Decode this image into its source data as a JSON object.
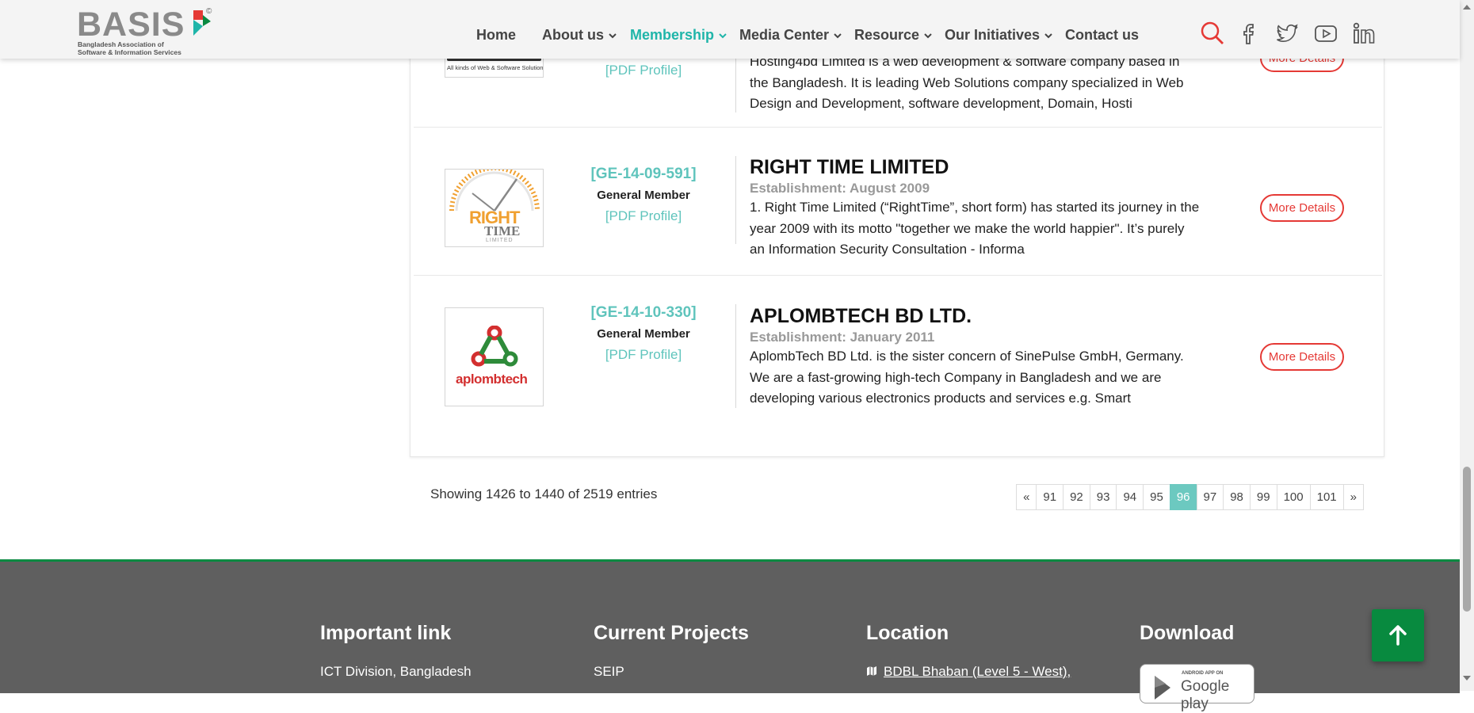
{
  "header": {
    "logo_text": "BASIS",
    "logo_reg": "©",
    "logo_sub_line1": "Bangladesh Association of",
    "logo_sub_line2": "Software & Information Services",
    "nav": [
      {
        "label": "Home"
      },
      {
        "label": "About us"
      },
      {
        "label": "Membership"
      },
      {
        "label": "Media Center"
      },
      {
        "label": "Resource"
      },
      {
        "label": "Our Initiatives"
      },
      {
        "label": "Contact us"
      }
    ],
    "icons": [
      "search-icon",
      "facebook-icon",
      "twitter-icon",
      "youtube-icon",
      "linkedin-icon"
    ],
    "accent_color": "#1fb5a9"
  },
  "members": [
    {
      "code": "",
      "type": "",
      "pdf_label": "[PDF Profile]",
      "logo_text": "All kinds of Web & Software Solution",
      "title": "",
      "establishment": "",
      "description": "Hosting4bd Limited is a web development & software company based in the Bangladesh. It is leading Web Solutions company specialized in Web Design and Development, software development, Domain, Hosti",
      "button": "More Details"
    },
    {
      "code": "[GE-14-09-591]",
      "type": "General Member",
      "pdf_label": "[PDF Profile]",
      "logo_text_top": "RIGHT",
      "logo_text_mid": "TIME",
      "logo_text_bot": "LIMITED",
      "title": "RIGHT TIME LIMITED",
      "establishment": "Establishment: August 2009",
      "description": "1. Right Time Limited (“RightTime”, short form) has started its journey in the year 2009 with its motto \"together we make the world happier\". It’s purely an Information Security Consultation - Informa",
      "button": "More Details"
    },
    {
      "code": "[GE-14-10-330]",
      "type": "General Member",
      "pdf_label": "[PDF Profile]",
      "logo_text": "aplombtech",
      "title": "APLOMBTECH BD LTD.",
      "establishment": "Establishment: January 2011",
      "description": "AplombTech BD Ltd. is the sister concern of SinePulse GmbH, Germany. We are a fast-growing high-tech Company in Bangladesh and we are developing various electronics products and services e.g. Smart",
      "button": "More Details"
    }
  ],
  "pagination": {
    "showing": "Showing 1426 to 1440 of 2519 entries",
    "prev": "«",
    "next": "»",
    "pages": [
      "91",
      "92",
      "93",
      "94",
      "95",
      "96",
      "97",
      "98",
      "99",
      "100",
      "101"
    ],
    "current": "96"
  },
  "footer": {
    "columns": [
      {
        "heading": "Important link",
        "link": "ICT Division, Bangladesh"
      },
      {
        "heading": "Current Projects",
        "link": "SEIP"
      },
      {
        "heading": "Location",
        "link": "BDBL Bhaban (Level 5 - West),"
      },
      {
        "heading": "Download",
        "link": ""
      }
    ],
    "gplay_small": "ANDROID APP ON",
    "gplay_big": "Google play"
  }
}
